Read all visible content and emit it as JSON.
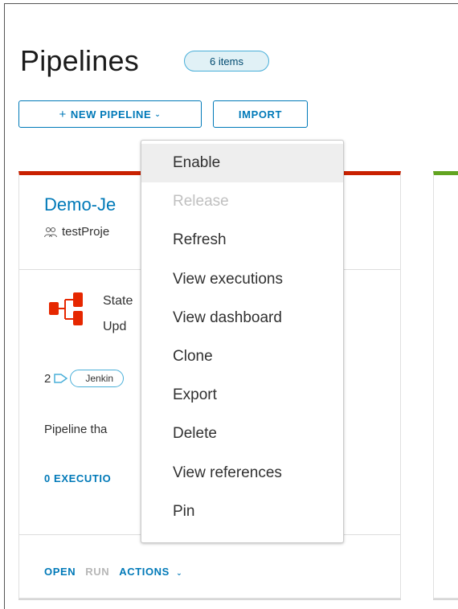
{
  "header": {
    "title": "Pipelines",
    "count_badge": "6 items",
    "new_pipeline_label": "NEW PIPELINE",
    "import_label": "IMPORT"
  },
  "card": {
    "title": "Demo-Je",
    "project": "testProje",
    "state_text": "State",
    "updated_text": "Upd",
    "tag_count": "2",
    "tag_chip": "Jenkin",
    "description": "Pipeline tha",
    "executions_link": "0 EXECUTIO",
    "accent_color": "#c92100"
  },
  "next_card": {
    "accent_color": "#62a420"
  },
  "footer": {
    "open_label": "OPEN",
    "run_label": "RUN",
    "actions_label": "ACTIONS"
  },
  "dropdown": {
    "items": [
      {
        "label": "Enable",
        "state": "hover"
      },
      {
        "label": "Release",
        "state": "disabled"
      },
      {
        "label": "Refresh",
        "state": "normal"
      },
      {
        "label": "View executions",
        "state": "normal"
      },
      {
        "label": "View dashboard",
        "state": "normal"
      },
      {
        "label": "Clone",
        "state": "normal"
      },
      {
        "label": "Export",
        "state": "normal"
      },
      {
        "label": "Delete",
        "state": "normal"
      },
      {
        "label": "View references",
        "state": "normal"
      },
      {
        "label": "Pin",
        "state": "normal"
      }
    ]
  },
  "icons": {
    "add": "plus-icon",
    "caret": "chevron-down-icon",
    "project": "users-icon",
    "pipeline": "pipeline-icon",
    "tag": "tag-icon"
  }
}
